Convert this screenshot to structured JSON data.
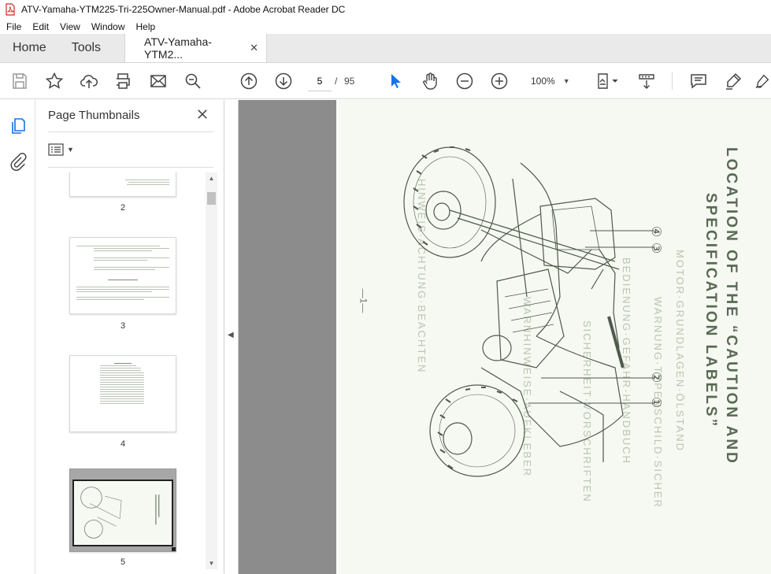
{
  "window": {
    "title": "ATV-Yamaha-YTM225-Tri-225Owner-Manual.pdf - Adobe Acrobat Reader DC"
  },
  "menu": [
    "File",
    "Edit",
    "View",
    "Window",
    "Help"
  ],
  "tabs": {
    "home": "Home",
    "tools": "Tools",
    "document": "ATV-Yamaha-YTM2...",
    "close_glyph": "✕"
  },
  "toolbar": {
    "current_page": "5",
    "page_separator": "/",
    "total_pages": "95",
    "zoom": "100%",
    "icons": [
      "save-icon",
      "bookmark-star-icon",
      "upload-icon",
      "print-icon",
      "email-icon",
      "search-icon",
      "page-up-icon",
      "page-down-icon",
      "select-cursor-icon",
      "hand-icon",
      "zoom-out-icon",
      "zoom-in-icon",
      "fit-page-icon",
      "scroll-mode-icon",
      "comment-icon",
      "highlight-icon",
      "sign-icon"
    ]
  },
  "side_panel": {
    "title": "Page Thumbnails",
    "close_glyph": "✕",
    "thumbnails": [
      {
        "label": "2"
      },
      {
        "label": "3"
      },
      {
        "label": "4"
      },
      {
        "label": "5",
        "selected": true
      }
    ]
  },
  "document_page": {
    "heading_line1": "LOCATION OF THE “CAUTION AND",
    "heading_line2": "SPECIFICATION LABELS”",
    "page_marker": "—1—",
    "callouts": [
      "①",
      "②",
      "③",
      "④"
    ]
  },
  "colors": {
    "accent": "#1473e6",
    "viewport_bg": "#8c8c8c",
    "page_bg": "#f6f8f2",
    "heading": "#596a54"
  }
}
